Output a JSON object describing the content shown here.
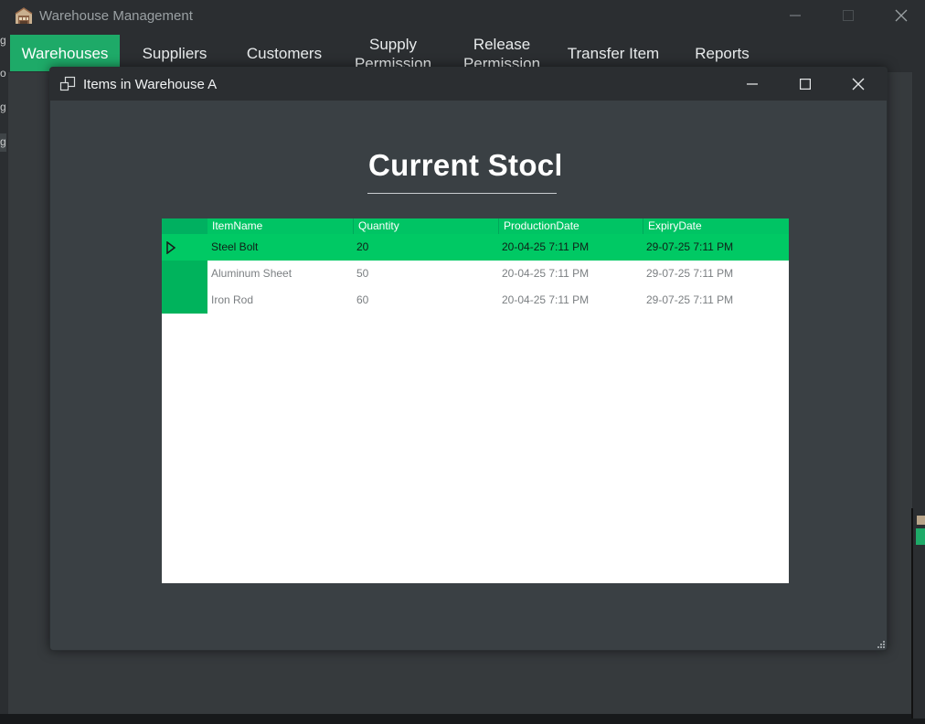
{
  "app": {
    "title": "Warehouse Management",
    "icon": "warehouse-app-icon"
  },
  "menu": {
    "items": [
      {
        "label": "Warehouses",
        "active": true
      },
      {
        "label": "Suppliers",
        "active": false
      },
      {
        "label": "Customers",
        "active": false
      },
      {
        "label": "Supply\nPermission",
        "active": false
      },
      {
        "label": "Release\nPermission",
        "active": false
      },
      {
        "label": "Transfer Item",
        "active": false
      },
      {
        "label": "Reports",
        "active": false
      }
    ]
  },
  "left_fragments": [
    "g",
    "o",
    "g",
    "g"
  ],
  "dialog": {
    "title": "Items in Warehouse A",
    "heading": "Current Stock",
    "grid": {
      "columns": [
        "ItemName",
        "Quantity",
        "ProductionDate",
        "ExpiryDate"
      ],
      "rows": [
        {
          "ItemName": "Steel Bolt",
          "Quantity": "20",
          "ProductionDate": "20-04-25 7:11 PM",
          "ExpiryDate": "29-07-25 7:11 PM",
          "selected": true
        },
        {
          "ItemName": "Aluminum Sheet",
          "Quantity": "50",
          "ProductionDate": "20-04-25 7:11 PM",
          "ExpiryDate": "29-07-25 7:11 PM",
          "selected": false
        },
        {
          "ItemName": "Iron Rod",
          "Quantity": "60",
          "ProductionDate": "20-04-25 7:11 PM",
          "ExpiryDate": "29-07-25 7:11 PM",
          "selected": false
        }
      ]
    }
  },
  "colors": {
    "accent": "#1eaa68",
    "grid_header": "#00c464",
    "selected_row": "#00c964",
    "window_bg": "#2b2e31",
    "dialog_bg": "#3a4044"
  }
}
